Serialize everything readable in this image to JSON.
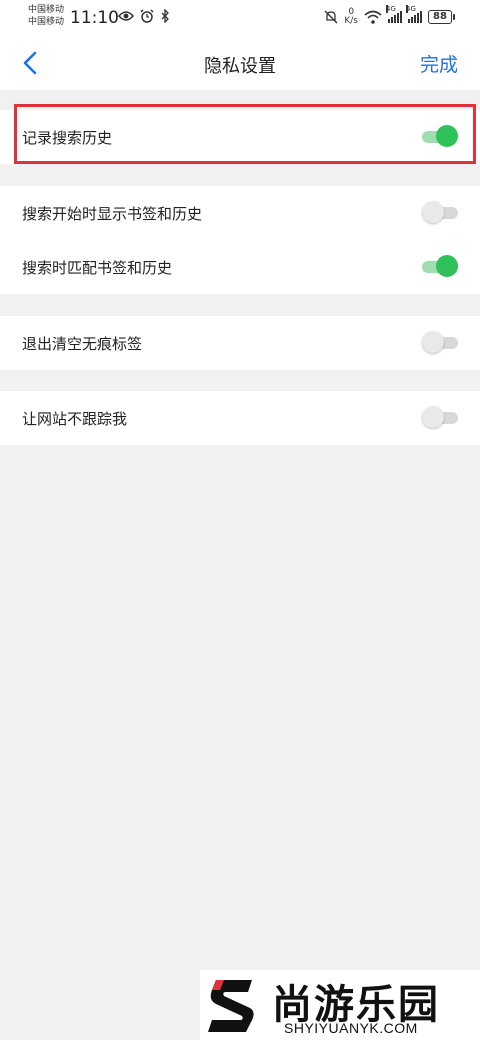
{
  "status_bar": {
    "carrier_1": "中国移动",
    "carrier_2": "中国移动",
    "time": "11:10",
    "net_speed_value": "0",
    "net_speed_unit": "K/s",
    "signal_1_label": "4G",
    "signal_2_label": "4G",
    "battery": "88"
  },
  "header": {
    "title": "隐私设置",
    "done_label": "完成",
    "accent_color": "#1a73e8"
  },
  "settings": {
    "group1": [
      {
        "label": "记录搜索历史",
        "enabled": true
      }
    ],
    "group2": [
      {
        "label": "搜索开始时显示书签和历史",
        "enabled": false
      },
      {
        "label": "搜索时匹配书签和历史",
        "enabled": true
      }
    ],
    "group3": [
      {
        "label": "退出清空无痕标签",
        "enabled": false
      }
    ],
    "group4": [
      {
        "label": "让网站不跟踪我",
        "enabled": false
      }
    ]
  },
  "colors": {
    "toggle_on": "#2fc25b",
    "highlight": "#e0323a"
  },
  "watermark": {
    "name": "尚游乐园",
    "url": "SHYIYUANYK.COM"
  }
}
